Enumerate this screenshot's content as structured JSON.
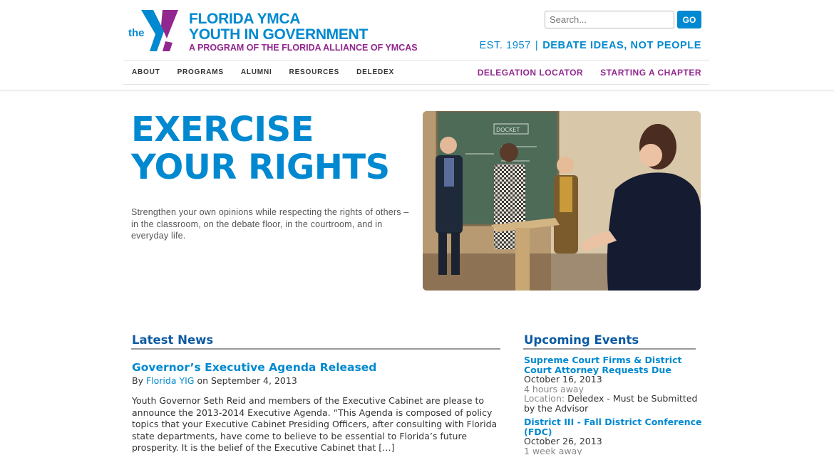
{
  "brand": {
    "logo_the": "the",
    "title_line1": "FLORIDA YMCA",
    "title_line2": "YOUTH IN GOVERNMENT",
    "subtitle": "A PROGRAM OF THE FLORIDA ALLIANCE OF YMCAS",
    "colors": {
      "blue": "#0089d0",
      "purple": "#92278f",
      "navy": "#0b5aa3"
    }
  },
  "search": {
    "placeholder": "Search...",
    "button_label": "GO"
  },
  "tagline": {
    "est": "EST. 1957",
    "separator": "|",
    "motto": "DEBATE IDEAS, NOT PEOPLE"
  },
  "nav": {
    "left": [
      {
        "label": "ABOUT"
      },
      {
        "label": "PROGRAMS"
      },
      {
        "label": "ALUMNI"
      },
      {
        "label": "RESOURCES"
      },
      {
        "label": "DELEDEX"
      }
    ],
    "right": [
      {
        "label": "DELEGATION LOCATOR"
      },
      {
        "label": "STARTING A CHAPTER"
      }
    ]
  },
  "hero": {
    "title": "EXERCISE YOUR RIGHTS",
    "text": "Strengthen your own opinions while respecting the rights of others – in the classroom, on the debate floor, in the courtroom, and in everyday life.",
    "photo_board_text": "DOCKET"
  },
  "news": {
    "heading": "Latest News",
    "post": {
      "title": "Governor’s Executive Agenda Released",
      "meta_by": "By",
      "author": "Florida YIG",
      "meta_date": "on September 4, 2013",
      "excerpt": "Youth Governor Seth Reid and members of the Executive Cabinet are please to announce the 2013-2014 Executive Agenda. “This Agenda is composed of policy topics that your Executive Cabinet Presiding Officers, after consulting with Florida state departments, have come to believe to be essential to Florida’s future prosperity. It is the belief of the Executive Cabinet that […]"
    }
  },
  "events": {
    "heading": "Upcoming Events",
    "items": [
      {
        "title": "Supreme Court Firms & District Court Attorney Requests Due",
        "date": "October 16, 2013",
        "relative": "4 hours away",
        "location_label": "Location:",
        "location": "Deledex - Must be Submitted by the Advisor"
      },
      {
        "title": "District III - Fall District Conference (FDC)",
        "date": "October 26, 2013",
        "relative": "1 week away"
      }
    ]
  }
}
